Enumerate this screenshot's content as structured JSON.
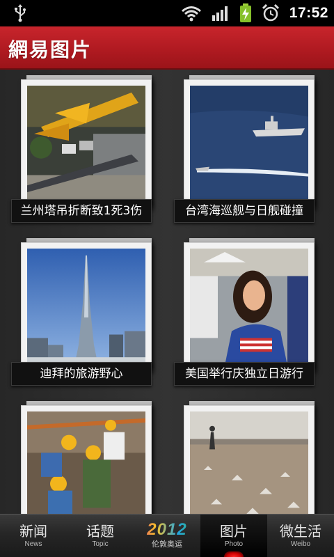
{
  "status_bar": {
    "time": "17:52",
    "icons": [
      "usb-icon",
      "wifi-icon",
      "signal-icon",
      "battery-charging-icon",
      "alarm-icon"
    ]
  },
  "header": {
    "title": "網易图片",
    "color": "#b51c22"
  },
  "gallery": {
    "items": [
      {
        "caption": "兰州塔吊折断致1死3伤"
      },
      {
        "caption": "台湾海巡舰与日舰碰撞"
      },
      {
        "caption": "迪拜的旅游野心"
      },
      {
        "caption": "美国举行庆独立日游行"
      },
      {
        "caption": ""
      },
      {
        "caption": ""
      }
    ]
  },
  "tabbar": {
    "tabs": [
      {
        "cn": "新闻",
        "en": "News"
      },
      {
        "cn": "话题",
        "en": "Topic"
      },
      {
        "cn": "2012",
        "en": "伦敦奥运"
      },
      {
        "cn": "图片",
        "en": "Photo",
        "active": true
      },
      {
        "cn": "微生活",
        "en": "Weibo"
      }
    ],
    "active_indicator_color": "#e01818"
  }
}
